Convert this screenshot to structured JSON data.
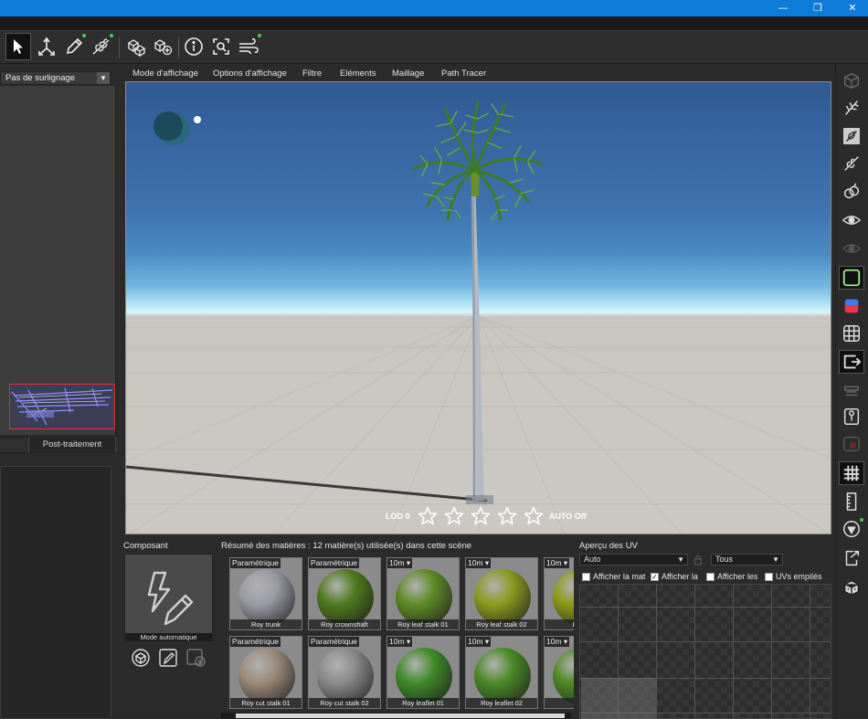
{
  "window": {
    "minimize_glyph": "—",
    "maximize_glyph": "❐",
    "close_glyph": "✕"
  },
  "toolbar": {
    "icons": [
      "select-arrow-icon",
      "transform-icon",
      "pencil-icon",
      "leaf-edit-icon",
      "cubes-icon",
      "cubes-add-icon",
      "info-icon",
      "focus-icon",
      "wind-icon"
    ]
  },
  "left_panel": {
    "highlight_select": "Pas de surlignage",
    "tab_post": "Post-traitement"
  },
  "menu": {
    "items": [
      "Mode d'affichage",
      "Options d'affichage",
      "Filtre",
      "Eléments",
      "Maillage",
      "Path Tracer"
    ]
  },
  "viewport": {
    "lod_label": "LOD 0",
    "auto_label": "AUTO Off",
    "stars": 5
  },
  "composant": {
    "title": "Composant",
    "mode": "Mode automatique"
  },
  "materials": {
    "title": "Résumé des matières : 12 matière(s) utilisée(s) dans cette scène",
    "row1": [
      {
        "tag": "Paramétrique",
        "name": "Roy trunk",
        "color": "#9a9aa6"
      },
      {
        "tag": "Paramétrique",
        "name": "Roy crownshaft",
        "color": "#4f7a1c"
      },
      {
        "tag": "10m",
        "name": "Roy leaf stalk 01",
        "color": "#5f8a26"
      },
      {
        "tag": "10m",
        "name": "Roy leaf stalk 02",
        "color": "#8a9a1e"
      },
      {
        "tag": "10m",
        "name": "Roy l",
        "color": "#8d9a18"
      }
    ],
    "row2": [
      {
        "tag": "Paramétrique",
        "name": "Roy cut stalk 01",
        "color": "#9a8a78"
      },
      {
        "tag": "Paramétrique",
        "name": "Roy cut stalk 02",
        "color": "#8a8a8a"
      },
      {
        "tag": "10m",
        "name": "Roy leaflet 01",
        "color": "#3f8a28"
      },
      {
        "tag": "10m",
        "name": "Roy leaflet 02",
        "color": "#4a8a26"
      },
      {
        "tag": "10m",
        "name": "Roy",
        "color": "#4f8a26"
      }
    ]
  },
  "uv": {
    "title": "Aperçu des UV",
    "select_auto": "Auto",
    "select_tous": "Tous",
    "checks": [
      {
        "label": "Afficher la mat",
        "checked": false
      },
      {
        "label": "Afficher la",
        "checked": true
      },
      {
        "label": "Afficher les",
        "checked": false
      },
      {
        "label": "UVs empilés",
        "checked": false
      }
    ]
  },
  "rightbar": {
    "icons": [
      "cube-outline-icon",
      "branch-icon",
      "leaf-icon",
      "leaf-branch-icon",
      "fruit-icon",
      "eye-icon",
      "eye-dim-icon",
      "frame-icon",
      "gradient-icon",
      "grid-icon",
      "arrow-box-icon",
      "layers-icon",
      "pin-icon",
      "red-box-icon",
      "hash-grid-icon",
      "ruler-icon",
      "compass-icon",
      "export-icon",
      "dice-icon"
    ]
  },
  "colors": {
    "titlebar": "#0e7bd8",
    "accent_green": "#3bd15a"
  }
}
